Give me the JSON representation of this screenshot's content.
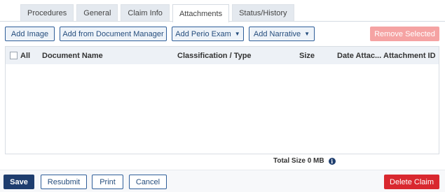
{
  "tabs": [
    {
      "label": "Procedures"
    },
    {
      "label": "General"
    },
    {
      "label": "Claim Info"
    },
    {
      "label": "Attachments",
      "active": true
    },
    {
      "label": "Status/History"
    }
  ],
  "toolbar": {
    "add_image": "Add Image",
    "add_from_doc_manager": "Add from Document Manager",
    "add_perio_exam": "Add Perio Exam",
    "add_narrative": "Add Narrative",
    "remove_selected": "Remove Selected"
  },
  "grid": {
    "columns": {
      "all": "All",
      "document_name": "Document Name",
      "classification": "Classification / Type",
      "size": "Size",
      "date_attached": "Date Attac...",
      "attachment_id": "Attachment ID"
    },
    "rows": []
  },
  "total_size": "Total Size 0 MB",
  "footer": {
    "save": "Save",
    "resubmit": "Resubmit",
    "print": "Print",
    "cancel": "Cancel",
    "delete_claim": "Delete Claim"
  },
  "colors": {
    "primary": "#1e3d6e",
    "danger": "#d9282f",
    "disabled_danger": "#f5a3a3",
    "header_bg": "#edf1f6"
  }
}
